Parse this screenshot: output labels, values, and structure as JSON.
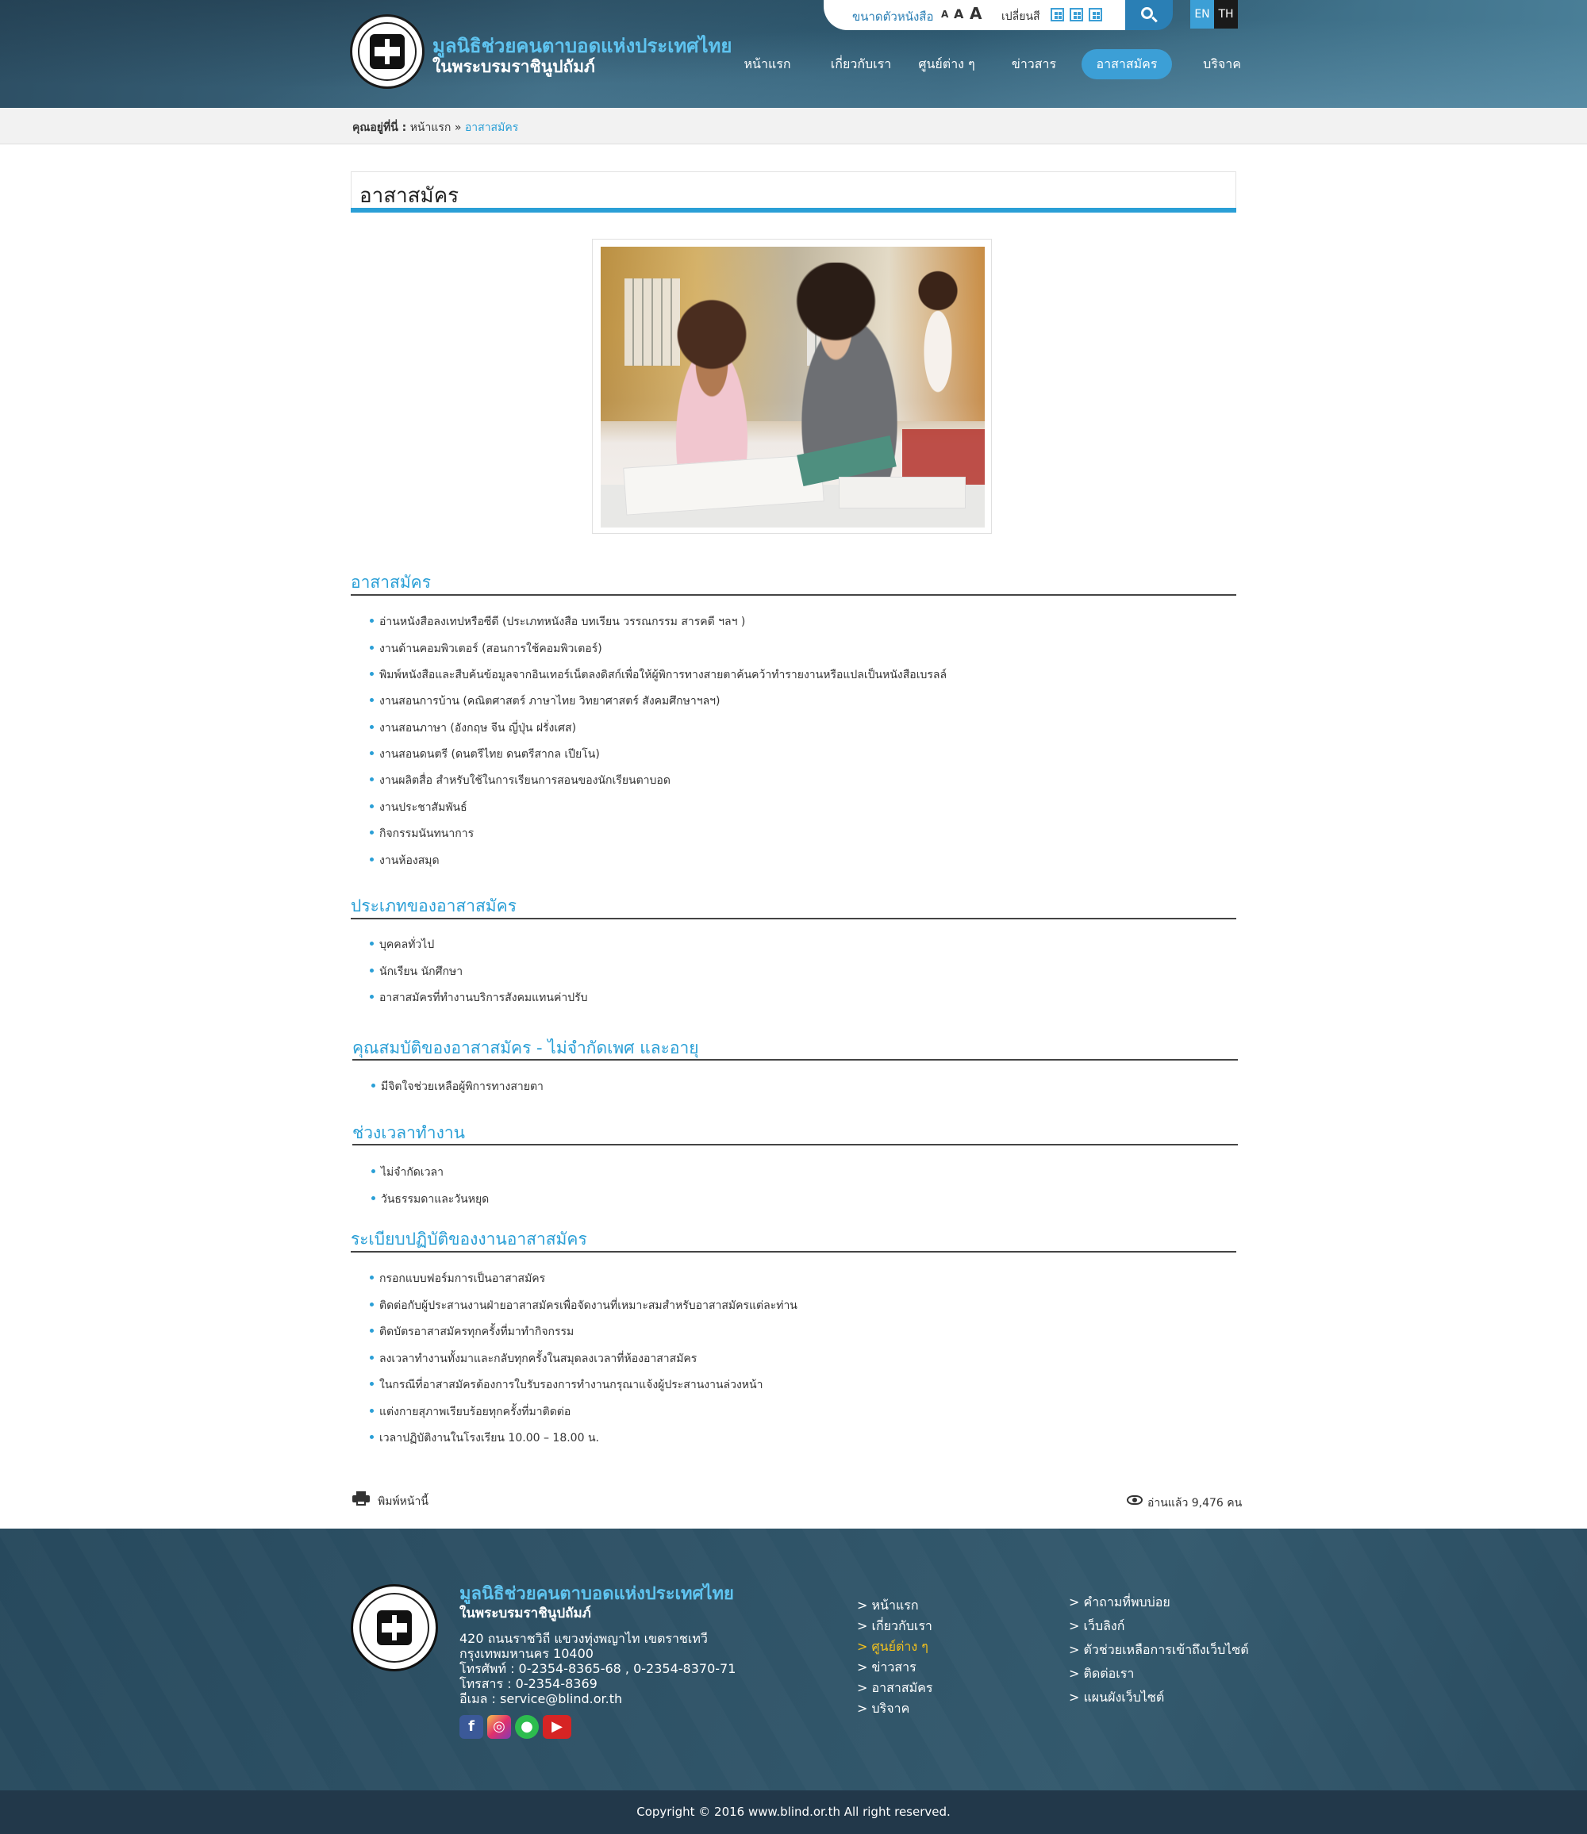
{
  "header": {
    "brand_line1": "มูลนิธิช่วยคนตาบอดแห่งประเทศไทย",
    "brand_line2": "ในพระบรมราชินูปถัมภ์",
    "font_size_label": "ขนาดตัวหนังสือ",
    "font_sizes": [
      "A",
      "A",
      "A"
    ],
    "color_scheme_label": "เปลี่ยนสี",
    "lang_en": "EN",
    "lang_th": "TH",
    "nav": [
      "หน้าแรก",
      "เกี่ยวกับเรา",
      "ศูนย์ต่าง ๆ",
      "ข่าวสาร",
      "อาสาสมัคร",
      "บริจาค"
    ],
    "active_nav": "อาสาสมัคร"
  },
  "breadcrumb": {
    "prefix": "คุณอยู่ที่นี่ :",
    "home": "หน้าแรก",
    "separator": "»",
    "current": "อาสาสมัคร"
  },
  "page_title": "อาสาสมัคร",
  "sections": [
    {
      "heading": "อาสาสมัคร",
      "items": [
        "อ่านหนังสือลงเทปหรือซีดี (ประเภทหนังสือ บทเรียน วรรณกรรม สารคดี ฯลฯ )",
        "งานด้านคอมพิวเตอร์ (สอนการใช้คอมพิวเตอร์)",
        "พิมพ์หนังสือและสืบค้นข้อมูลจากอินเทอร์เน็ตลงดิสก์เพื่อให้ผู้พิการทางสายตาค้นคว้าทำรายงานหรือแปลเป็นหนังสือเบรลล์",
        "งานสอนการบ้าน (คณิตศาสตร์ ภาษาไทย วิทยาศาสตร์ สังคมศึกษาฯลฯ)",
        "งานสอนภาษา (อังกฤษ จีน ญี่ปุ่น ฝรั่งเศส)",
        "งานสอนดนตรี (ดนตรีไทย ดนตรีสากล เปียโน)",
        "งานผลิตสื่อ สำหรับใช้ในการเรียนการสอนของนักเรียนตาบอด",
        "งานประชาสัมพันธ์",
        "กิจกรรมนันทนาการ",
        "งานห้องสมุด"
      ]
    },
    {
      "heading": "ประเภทของอาสาสมัคร",
      "items": [
        "บุคคลทั่วไป",
        "นักเรียน นักศึกษา",
        "อาสาสมัครที่ทำงานบริการสังคมแทนค่าปรับ"
      ]
    },
    {
      "heading": "คุณสมบัติของอาสาสมัคร - ไม่จำกัดเพศ และอายุ",
      "items": [
        "มีจิตใจช่วยเหลือผู้พิการทางสายตา"
      ]
    },
    {
      "heading": "ช่วงเวลาทำงาน",
      "items": [
        "ไม่จำกัดเวลา",
        "วันธรรมดาและวันหยุด"
      ]
    },
    {
      "heading": "ระเบียบปฏิบัติของงานอาสาสมัคร",
      "items": [
        "กรอกแบบฟอร์มการเป็นอาสาสมัคร",
        "ติดต่อกับผู้ประสานงานฝ่ายอาสาสมัครเพื่อจัดงานที่เหมาะสมสำหรับอาสาสมัครแต่ละท่าน",
        "ติดบัตรอาสาสมัครทุกครั้งที่มาทำกิจกรรม",
        "ลงเวลาทำงานทั้งมาและกลับทุกครั้งในสมุดลงเวลาที่ห้องอาสาสมัคร",
        "ในกรณีที่อาสาสมัครต้องการใบรับรองการทำงานกรุณาแจ้งผู้ประสานงานล่วงหน้า",
        "แต่งกายสุภาพเรียบร้อยทุกครั้งที่มาติดต่อ",
        "เวลาปฏิบัติงานในโรงเรียน 10.00 – 18.00 น."
      ]
    }
  ],
  "print_label": "พิมพ์หน้านี้",
  "views_label": "อ่านแล้ว 9,476 คน",
  "footer": {
    "brand_line1": "มูลนิธิช่วยคนตาบอดแห่งประเทศไทย",
    "brand_line2": "ในพระบรมราชินูปถัมภ์",
    "address": [
      "420 ถนนราชวิถี แขวงทุ่งพญาไท เขตราชเทวี",
      "กรุงเทพมหานคร 10400",
      "โทรศัพท์ : 0-2354-8365-68 , 0-2354-8370-71",
      "โทรสาร : 0-2354-8369",
      "อีเมล : service@blind.or.th"
    ],
    "links_col1": [
      "> หน้าแรก",
      "> เกี่ยวกับเรา",
      "> ศูนย์ต่าง ๆ",
      "> ข่าวสาร",
      "> อาสาสมัคร",
      "> บริจาค"
    ],
    "links_col2": [
      "> คำถามที่พบบ่อย",
      "> เว็บลิงก์",
      "> ตัวช่วยเหลือการเข้าถึงเว็บไซต์",
      "> ติดต่อเรา",
      "> แผนผังเว็บไซต์"
    ],
    "highlight_link": "> ศูนย์ต่าง ๆ",
    "copyright": "Copyright © 2016 www.blind.or.th All right reserved."
  },
  "colors": {
    "accent": "#2a9fd6",
    "header_bg": "#3d6a82",
    "footer_bg": "#2e5266",
    "highlight": "#f5c21b"
  }
}
